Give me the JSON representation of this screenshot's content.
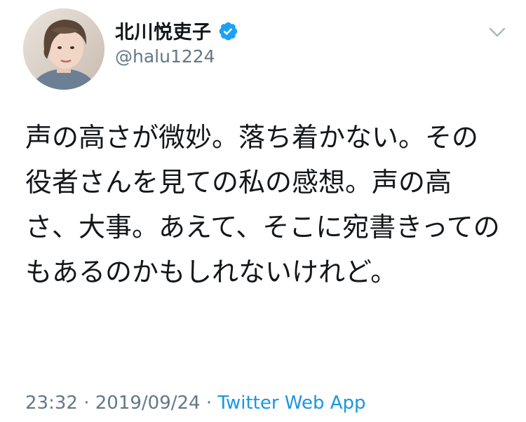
{
  "user": {
    "display_name": "北川悦吏子",
    "handle": "@halu1224",
    "verified": true
  },
  "tweet": {
    "text": "声の高さが微妙。落ち着かない。その役者さんを見ての私の感想。声の高さ、大事。あえて、そこに宛書きってのもあるのかもしれないけれど。",
    "time": "23:32",
    "separator": " · ",
    "date": "2019/09/24",
    "source": "Twitter Web App"
  },
  "icons": {
    "verified": "verified-badge-icon",
    "more": "chevron-down-icon"
  },
  "colors": {
    "verified_blue": "#1da1f2",
    "link_blue": "#1b95e0",
    "secondary_text": "#657786"
  }
}
